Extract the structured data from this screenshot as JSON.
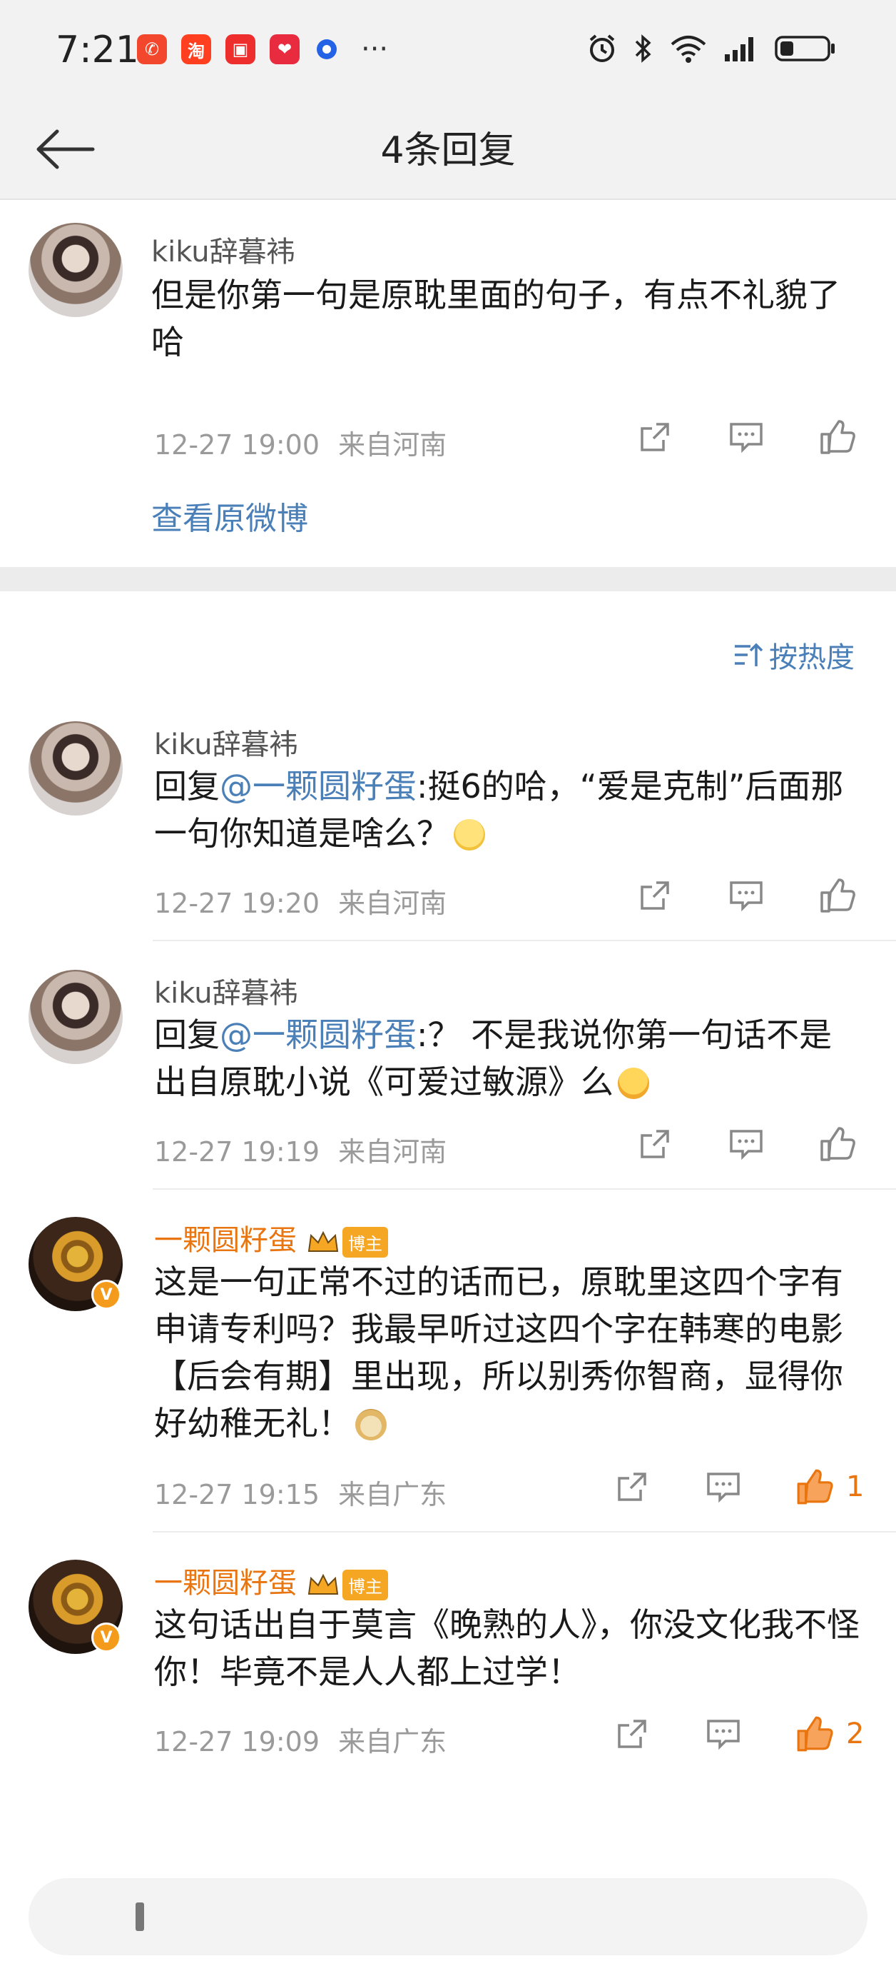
{
  "status_bar": {
    "time": "7:21",
    "app_icons": [
      {
        "name": "red-app-icon",
        "glyph": "✆",
        "color": "#f2472d"
      },
      {
        "name": "taobao-app-icon",
        "glyph": "淘",
        "color": "#ff3f1f"
      },
      {
        "name": "book-app-icon",
        "glyph": "▣",
        "color": "#ee2d2d"
      },
      {
        "name": "health-app-icon",
        "glyph": "❤",
        "color": "#e92b3f"
      }
    ],
    "more": "···"
  },
  "nav": {
    "title": "4条回复"
  },
  "root_comment": {
    "username": "kiku辞暮袆",
    "text": "但是你第一句是原耽里面的句子，有点不礼貌了哈",
    "time": "12-27 19:00",
    "location": "来自河南",
    "view_original": "查看原微博"
  },
  "sort_label": "按热度",
  "replies": [
    {
      "username": "kiku辞暮袆",
      "mention": "@一颗圆籽蛋",
      "text_after": ":挺6的哈，“爱是克制”后面那一句你知道是啥么？",
      "time": "12-27 19:20",
      "location": "来自河南"
    },
    {
      "username": "kiku辞暮袆",
      "mention": "@一颗圆籽蛋",
      "text_after": ":？ 不是我说你第一句话不是出自原耽小说《可爱过敏源》么",
      "time": "12-27 19:19",
      "location": "来自河南"
    },
    {
      "username": "一颗圆籽蛋",
      "badge": "博主",
      "text": "这是一句正常不过的话而已，原耽里这四个字有申请专利吗？我最早听过这四个字在韩寒的电影【后会有期】里出现，所以别秀你智商，显得你好幼稚无礼！",
      "time": "12-27 19:15",
      "location": "来自广东",
      "likes": "1"
    },
    {
      "username": "一颗圆籽蛋",
      "badge": "博主",
      "text": "这句话出自于莫言《晚熟的人》，你没文化我不怪你！毕竟不是人人都上过学！",
      "time": "12-27 19:09",
      "location": "来自广东",
      "likes": "2"
    }
  ],
  "reply_word": "回复",
  "colors": {
    "accent": "#4a7fb8",
    "like_active": "#e8750f",
    "muted": "#9a9a9a"
  }
}
